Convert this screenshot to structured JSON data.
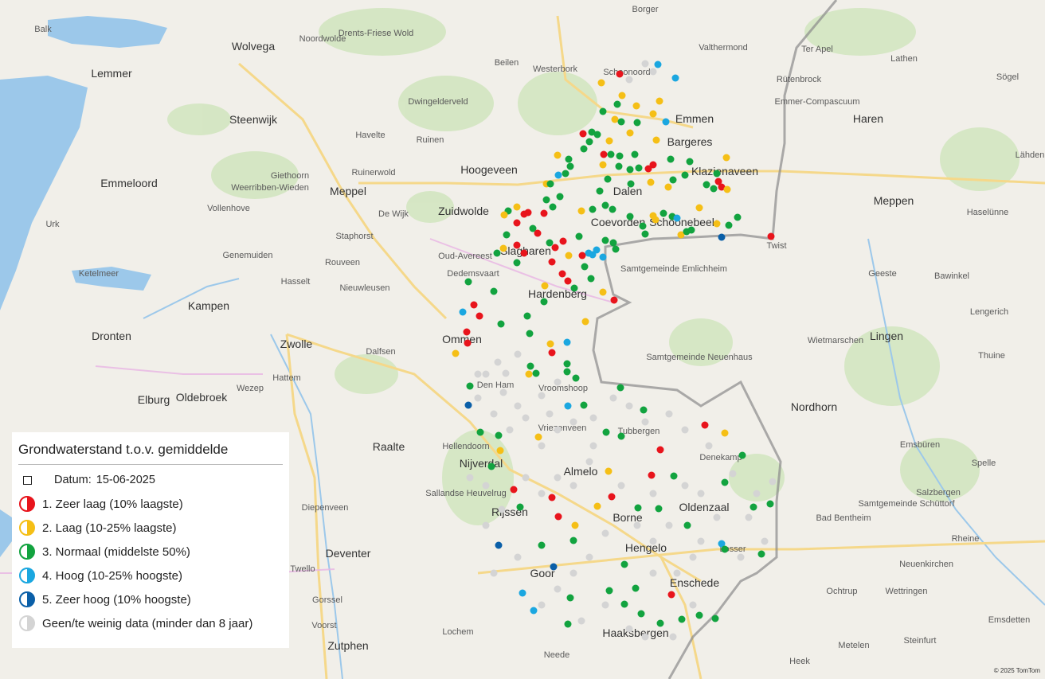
{
  "map": {
    "cities_big": [
      "Lemmer",
      "Wolvega",
      "Steenwijk",
      "Emmeloord",
      "Meppel",
      "Hoogeveen",
      "Emmen",
      "Coevorden",
      "Hardenberg",
      "Kampen",
      "Dronten",
      "Zwolle",
      "Ommen",
      "Almelo",
      "Hengelo",
      "Enschede",
      "Oldenzaal",
      "Deventer",
      "Nordhorn",
      "Lingen",
      "Meppen",
      "Haren",
      "Borne",
      "Rijssen",
      "Elburg",
      "Oldebroek",
      "Raalte",
      "Nijverdal",
      "Bargeres",
      "Klazienaveen",
      "Dalen",
      "Schoonebeek",
      "Slagharen",
      "Zuidwolde",
      "Goor",
      "Haaksbergen",
      "Zutphen"
    ],
    "cities_small": [
      "Balk",
      "Noordwolde",
      "Drents-Friese Wold",
      "Beilen",
      "Westerbork",
      "Borger",
      "Valthermond",
      "Ter Apel",
      "Lathen",
      "Sögel",
      "Rütenbrock",
      "Emmer-Compascuum",
      "Dwingelderveld",
      "Havelte",
      "Ruinen",
      "Ruinerwold",
      "Giethoorn",
      "Weerribben-Wieden",
      "Vollenhove",
      "De Wijk",
      "Staphorst",
      "Genemuiden",
      "Rouveen",
      "Urk",
      "Hasselt",
      "Nieuwleusen",
      "Ketelmeer",
      "Oud-Avereest",
      "Dedemsvaart",
      "Samtgemeinde Emlichheim",
      "Twist",
      "Haselünne",
      "Geeste",
      "Bawinkel",
      "Lengerich",
      "Wietmarschen",
      "Samtgemeinde Neuenhaus",
      "Dalfsen",
      "Hattem",
      "Wezep",
      "Den Ham",
      "Vroomshoop",
      "Vriezenveen",
      "Tubbergen",
      "Denekamp",
      "Hellendoorn",
      "Sallandse Heuvelrug",
      "Diepenveen",
      "Twello",
      "Gorssel",
      "Voorst",
      "Lochem",
      "Neede",
      "Losser",
      "Bad Bentheim",
      "Samtgemeinde Schüttorf",
      "Salzbergen",
      "Rheine",
      "Spelle",
      "Emsbüren",
      "Neuenkirchen",
      "Wettringen",
      "Ochtrup",
      "Steinfurt",
      "Metelen",
      "Emsdetten",
      "Heek",
      "Thuine",
      "Lähden",
      "Schoonoord"
    ]
  },
  "legend": {
    "title": "Grondwaterstand t.o.v. gemiddelde",
    "date_label": "Datum:",
    "date_value": "15-06-2025",
    "items": [
      {
        "label": "1. Zeer laag (10% laagste)",
        "color": "#e8141c"
      },
      {
        "label": "2. Laag (10-25% laagste)",
        "color": "#f5bf16"
      },
      {
        "label": "3. Normaal (middelste 50%)",
        "color": "#12a33f"
      },
      {
        "label": "4. Hoog (10-25% hoogste)",
        "color": "#1ba7e0"
      },
      {
        "label": "5. Zeer hoog (10% hoogste)",
        "color": "#0a5fa8"
      },
      {
        "label": "Geen/te weinig data (minder dan 8 jaar)",
        "color": "#d4d4d4"
      }
    ]
  },
  "copyright": "© 2025 TomTom"
}
